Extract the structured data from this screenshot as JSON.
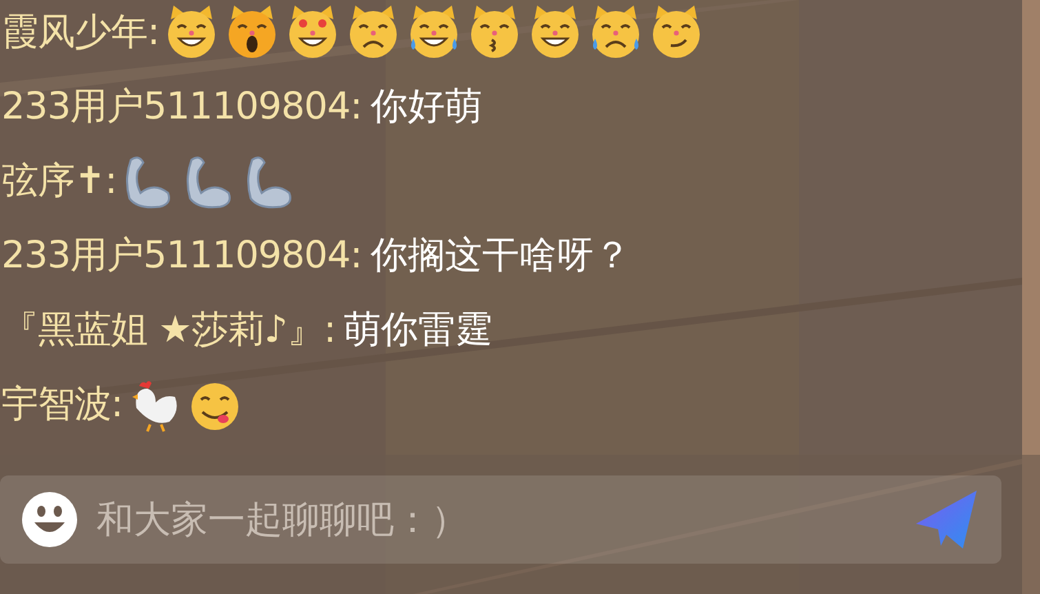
{
  "messages": [
    {
      "user": "霞风少年:",
      "stickers": [
        {
          "kind": "cat_grin"
        },
        {
          "kind": "cat_scream"
        },
        {
          "kind": "cat_heart"
        },
        {
          "kind": "cat_sad"
        },
        {
          "kind": "cat_cry"
        },
        {
          "kind": "cat_kiss"
        },
        {
          "kind": "cat_grin"
        },
        {
          "kind": "cat_tear"
        },
        {
          "kind": "cat_smirk"
        }
      ]
    },
    {
      "user": "233用户511109804:",
      "text": "你好萌"
    },
    {
      "user": "弦序✝:",
      "stickers": [
        {
          "kind": "arm"
        },
        {
          "kind": "arm"
        },
        {
          "kind": "arm"
        }
      ]
    },
    {
      "user": "233用户511109804:",
      "text": "你搁这干啥呀？"
    },
    {
      "user": "『黑蓝姐 ★莎莉♪』:",
      "text": "萌你雷霆"
    },
    {
      "user": "宇智波:",
      "stickers": [
        {
          "kind": "chicken"
        },
        {
          "kind": "yum"
        }
      ]
    }
  ],
  "input": {
    "placeholder": "和大家一起聊聊吧：）"
  }
}
